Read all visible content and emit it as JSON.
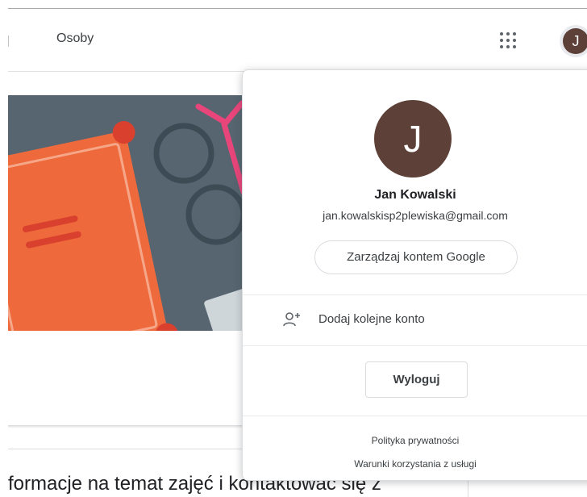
{
  "header": {
    "tab_people": "Osoby",
    "apps_icon": "apps-grid-icon",
    "avatar_initial": "J"
  },
  "main": {
    "info_text": "formacje na temat zajęć i kontaktować się z"
  },
  "account_panel": {
    "avatar_initial": "J",
    "name": "Jan Kowalski",
    "email": "jan.kowalskisp2plewiska@gmail.com",
    "manage_button": "Zarządzaj kontem Google",
    "add_account_icon": "person-add-icon",
    "add_account_label": "Dodaj kolejne konto",
    "logout_button": "Wyloguj",
    "privacy_link": "Polityka prywatności",
    "terms_link": "Warunki korzystania z usługi"
  },
  "colors": {
    "avatar_bg": "#5d4037",
    "banner_bg": "#566570",
    "book_orange": "#ee6a3c",
    "accent_pink": "#e8457a"
  }
}
